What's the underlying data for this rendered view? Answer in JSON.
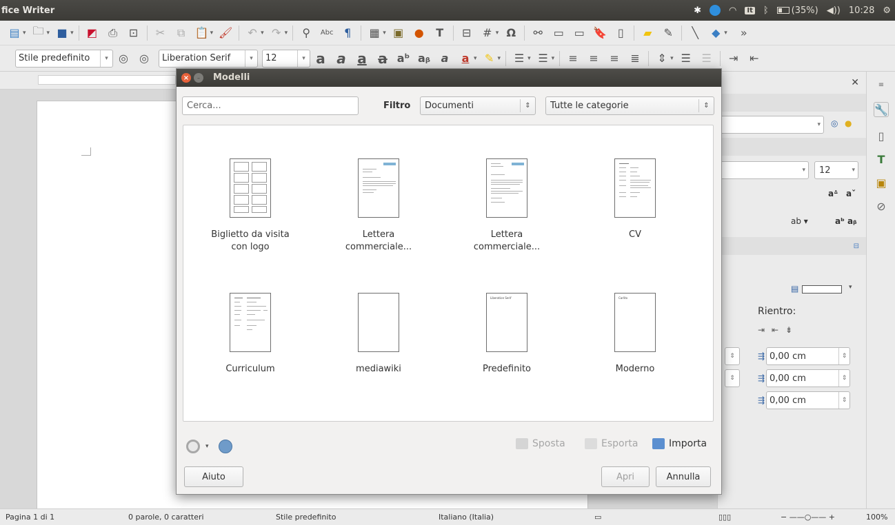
{
  "topbar": {
    "app_title": "fice Writer",
    "battery": "(35%)",
    "time": "10:28",
    "kbd": "It"
  },
  "toolbar2": {
    "paragraph_style": "Stile predefinito",
    "font_name": "Liberation Serif",
    "font_size": "12"
  },
  "sidebar": {
    "font_size": "12",
    "rientro_label": "Rientro:",
    "indent_values": [
      "0,00 cm",
      "0,00 cm",
      "0,00 cm"
    ]
  },
  "statusbar": {
    "page": "Pagina 1 di 1",
    "words": "0 parole, 0 caratteri",
    "style": "Stile predefinito",
    "language": "Italiano (Italia)",
    "zoom": "100%"
  },
  "dialog": {
    "title": "Modelli",
    "search_placeholder": "Cerca...",
    "filter_label": "Filtro",
    "filter_value": "Documenti",
    "category_value": "Tutte le categorie",
    "templates": [
      {
        "label": "Biglietto da visita con logo",
        "icon": "business-card-thumbnail"
      },
      {
        "label": "Lettera commerciale...",
        "icon": "letter-thumbnail"
      },
      {
        "label": "Lettera commerciale...",
        "icon": "letter-thumbnail"
      },
      {
        "label": "CV",
        "icon": "cv-thumbnail"
      },
      {
        "label": "Curriculum",
        "icon": "curriculum-thumbnail"
      },
      {
        "label": "mediawiki",
        "icon": "blank-thumbnail"
      },
      {
        "label": "Predefinito",
        "icon": "default-thumbnail",
        "thumb_text": "Liberation Serif"
      },
      {
        "label": "Moderno",
        "icon": "modern-thumbnail",
        "thumb_text": "Carlito"
      }
    ],
    "actions": {
      "move": "Sposta",
      "export": "Esporta",
      "import": "Importa"
    },
    "buttons": {
      "help": "Aiuto",
      "open": "Apri",
      "cancel": "Annulla"
    }
  }
}
